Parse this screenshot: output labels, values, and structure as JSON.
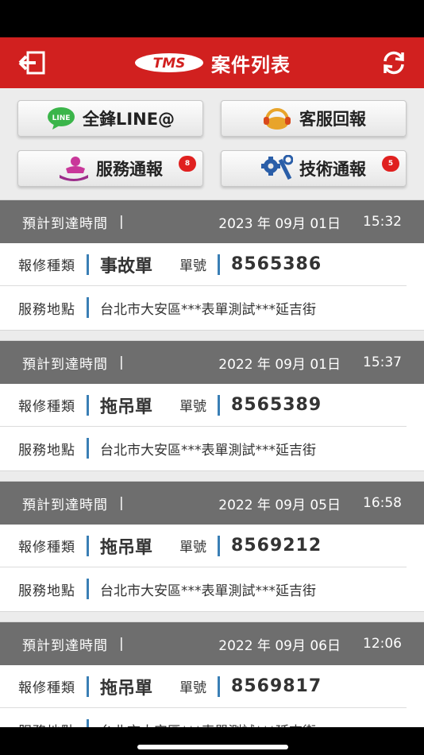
{
  "header": {
    "logo_text": "TMS",
    "title": "案件列表",
    "back_icon": "exit-icon",
    "refresh_icon": "refresh-icon"
  },
  "quick_buttons": [
    {
      "label": "全鋒LINE@",
      "icon": "line-icon",
      "badge": ""
    },
    {
      "label": "客服回報",
      "icon": "headset-icon",
      "badge": ""
    },
    {
      "label": "服務通報",
      "icon": "service-person-icon",
      "badge": "8"
    },
    {
      "label": "技術通報",
      "icon": "tools-icon",
      "badge": "5"
    }
  ],
  "labels": {
    "eta": "預計到達時間",
    "sep": "|",
    "repair_type": "報修種類",
    "order_no": "單號",
    "location": "服務地點"
  },
  "cases": [
    {
      "date": "2023 年 09月 01日",
      "time": "15:32",
      "type": "事故單",
      "no": "8565386",
      "address": "台北市大安區***表單測試***延吉街"
    },
    {
      "date": "2022 年 09月 01日",
      "time": "15:37",
      "type": "拖吊單",
      "no": "8565389",
      "address": "台北市大安區***表單測試***延吉街"
    },
    {
      "date": "2022 年 09月 05日",
      "time": "16:58",
      "type": "拖吊單",
      "no": "8569212",
      "address": "台北市大安區***表單測試***延吉街"
    },
    {
      "date": "2022 年 09月 06日",
      "time": "12:06",
      "type": "拖吊單",
      "no": "8569817",
      "address": "台北市大安區***表單測試***延吉街"
    }
  ],
  "colors": {
    "nav_bg": "#d1201f",
    "card_head_bg": "#6e6e6e",
    "accent_bar": "#3a7fb5",
    "badge": "#e0201f"
  }
}
